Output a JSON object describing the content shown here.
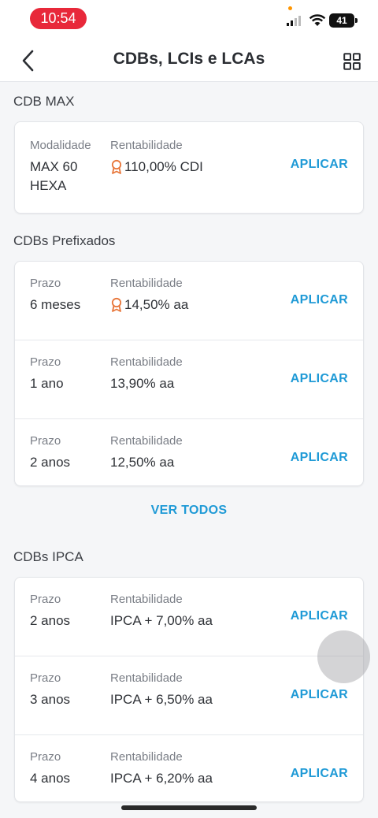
{
  "status_bar": {
    "time": "10:54",
    "battery": "41"
  },
  "nav": {
    "title": "CDBs, LCIs e LCAs"
  },
  "sections": {
    "max": {
      "title": "CDB MAX",
      "row": {
        "label1": "Modalidade",
        "value1": "MAX 60\nHEXA",
        "label2": "Rentabilidade",
        "value2": "110,00% CDI",
        "medal": true,
        "action": "APLICAR"
      }
    },
    "prefixados": {
      "title": "CDBs Prefixados",
      "rows": [
        {
          "label1": "Prazo",
          "value1": "6 meses",
          "label2": "Rentabilidade",
          "value2": "14,50% aa",
          "medal": true,
          "action": "APLICAR"
        },
        {
          "label1": "Prazo",
          "value1": "1 ano",
          "label2": "Rentabilidade",
          "value2": "13,90% aa",
          "medal": false,
          "action": "APLICAR"
        },
        {
          "label1": "Prazo",
          "value1": "2 anos",
          "label2": "Rentabilidade",
          "value2": "12,50% aa",
          "medal": false,
          "action": "APLICAR"
        }
      ],
      "see_all": "VER TODOS"
    },
    "ipca": {
      "title": "CDBs IPCA",
      "rows": [
        {
          "label1": "Prazo",
          "value1": "2 anos",
          "label2": "Rentabilidade",
          "value2": "IPCA + 7,00% aa",
          "medal": false,
          "action": "APLICAR"
        },
        {
          "label1": "Prazo",
          "value1": "3 anos",
          "label2": "Rentabilidade",
          "value2": "IPCA + 6,50% aa",
          "medal": false,
          "action": "APLICAR"
        },
        {
          "label1": "Prazo",
          "value1": "4 anos",
          "label2": "Rentabilidade",
          "value2": "IPCA + 6,20% aa",
          "medal": false,
          "action": "APLICAR"
        }
      ]
    }
  },
  "colors": {
    "accent": "#1f9ad6",
    "medal": "#e8763a",
    "time_pill": "#e8283a"
  },
  "icons": {
    "back": "chevron-left-icon",
    "grid": "grid-icon",
    "medal": "medal-icon"
  }
}
